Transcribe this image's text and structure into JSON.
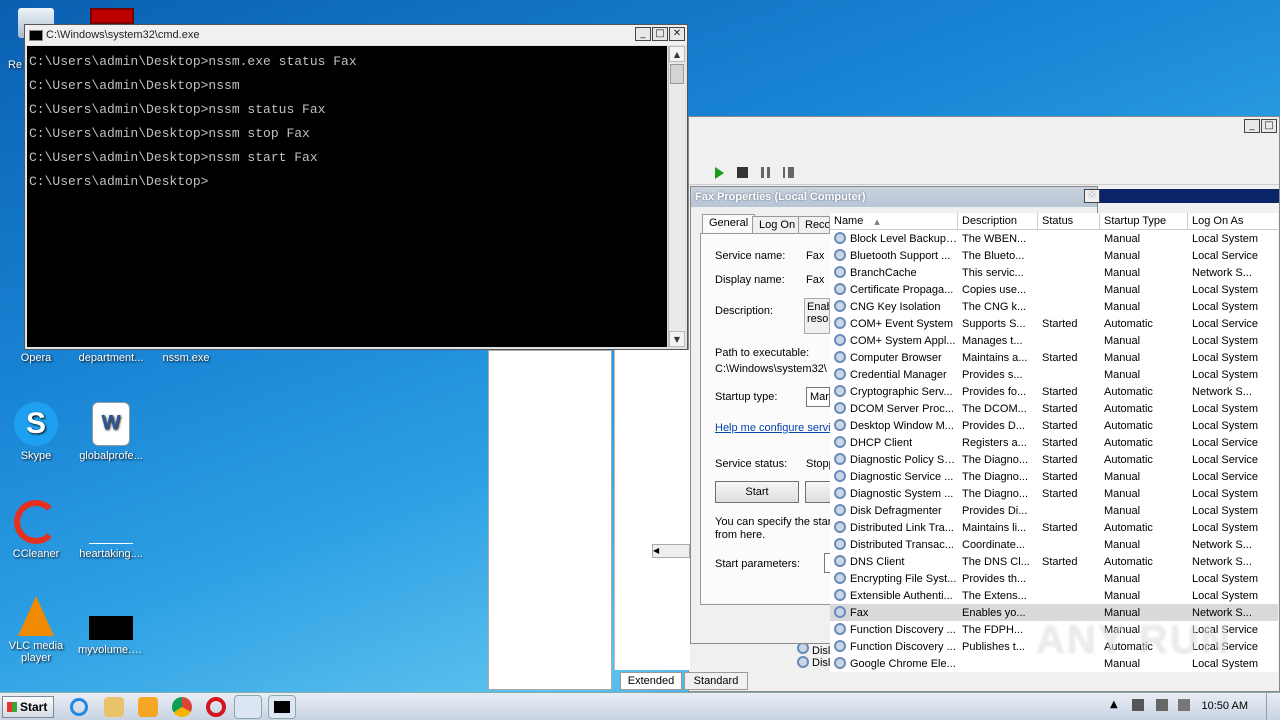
{
  "desktop": {
    "icons": [
      {
        "label": "Opera",
        "color": "#d4141e"
      },
      {
        "label": "department...",
        "color": "#2f7fd0"
      },
      {
        "label": "nssm.exe",
        "color": "#5a6f8a"
      },
      {
        "label": "Skype",
        "color": "#1ea0f0"
      },
      {
        "label": "globalprofe...",
        "color": "#2b579a"
      },
      {
        "label": "CCleaner",
        "color": "#e53020"
      },
      {
        "label": "heartaking....",
        "color": "#ffffff"
      },
      {
        "label": "VLC media player",
        "color": "#f08a00"
      },
      {
        "label": "myvolume.jpg",
        "color": "#000000"
      }
    ],
    "partial_labels": [
      "Re"
    ]
  },
  "cmd": {
    "title": "C:\\Windows\\system32\\cmd.exe",
    "lines": [
      "C:\\Users\\admin\\Desktop>nssm.exe status Fax",
      "C:\\Users\\admin\\Desktop>nssm",
      "C:\\Users\\admin\\Desktop>nssm status Fax",
      "C:\\Users\\admin\\Desktop>nssm stop Fax",
      "C:\\Users\\admin\\Desktop>nssm start Fax",
      "C:\\Users\\admin\\Desktop>"
    ]
  },
  "fax": {
    "title": "Fax Properties (Local Computer)",
    "tabs": [
      "General",
      "Log On",
      "Reco"
    ],
    "service_name_label": "Service name:",
    "service_name_value": "Fax",
    "display_name_label": "Display name:",
    "display_name_value": "Fax",
    "description_label": "Description:",
    "description_value_1": "Enab",
    "description_value_2": "reso",
    "path_label": "Path to executable:",
    "path_value": "C:\\Windows\\system32\\",
    "startup_type_label": "Startup type:",
    "startup_type_value": "Mar",
    "help_link": "Help me configure servic",
    "status_label": "Service status:",
    "status_value": "Stopp",
    "start_button": "Start",
    "hint_1": "You can specify the star",
    "hint_2": "from here.",
    "params_label": "Start parameters:"
  },
  "services": {
    "columns": [
      "Name",
      "Description",
      "Status",
      "Startup Type",
      "Log On As"
    ],
    "rows": [
      [
        "Block Level Backup ...",
        "The WBEN...",
        "",
        "Manual",
        "Local System"
      ],
      [
        "Bluetooth Support ...",
        "The Blueto...",
        "",
        "Manual",
        "Local Service"
      ],
      [
        "BranchCache",
        "This servic...",
        "",
        "Manual",
        "Network S..."
      ],
      [
        "Certificate Propaga...",
        "Copies use...",
        "",
        "Manual",
        "Local System"
      ],
      [
        "CNG Key Isolation",
        "The CNG k...",
        "",
        "Manual",
        "Local System"
      ],
      [
        "COM+ Event System",
        "Supports S...",
        "Started",
        "Automatic",
        "Local Service"
      ],
      [
        "COM+ System Appl...",
        "Manages t...",
        "",
        "Manual",
        "Local System"
      ],
      [
        "Computer Browser",
        "Maintains a...",
        "Started",
        "Manual",
        "Local System"
      ],
      [
        "Credential Manager",
        "Provides s...",
        "",
        "Manual",
        "Local System"
      ],
      [
        "Cryptographic Serv...",
        "Provides fo...",
        "Started",
        "Automatic",
        "Network S..."
      ],
      [
        "DCOM Server Proc...",
        "The DCOM...",
        "Started",
        "Automatic",
        "Local System"
      ],
      [
        "Desktop Window M...",
        "Provides D...",
        "Started",
        "Automatic",
        "Local System"
      ],
      [
        "DHCP Client",
        "Registers a...",
        "Started",
        "Automatic",
        "Local Service"
      ],
      [
        "Diagnostic Policy Se...",
        "The Diagno...",
        "Started",
        "Automatic",
        "Local Service"
      ],
      [
        "Diagnostic Service ...",
        "The Diagno...",
        "Started",
        "Manual",
        "Local Service"
      ],
      [
        "Diagnostic System ...",
        "The Diagno...",
        "Started",
        "Manual",
        "Local System"
      ],
      [
        "Disk Defragmenter",
        "Provides Di...",
        "",
        "Manual",
        "Local System"
      ],
      [
        "Distributed Link Tra...",
        "Maintains li...",
        "Started",
        "Automatic",
        "Local System"
      ],
      [
        "Distributed Transac...",
        "Coordinate...",
        "",
        "Manual",
        "Network S..."
      ],
      [
        "DNS Client",
        "The DNS Cl...",
        "Started",
        "Automatic",
        "Network S..."
      ],
      [
        "Encrypting File Syst...",
        "Provides th...",
        "",
        "Manual",
        "Local System"
      ],
      [
        "Extensible Authenti...",
        "The Extens...",
        "",
        "Manual",
        "Local System"
      ],
      [
        "Fax",
        "Enables yo...",
        "",
        "Manual",
        "Network S..."
      ],
      [
        "Function Discovery ...",
        "The FDPH...",
        "",
        "Manual",
        "Local Service"
      ],
      [
        "Function Discovery ...",
        "Publishes t...",
        "",
        "Automatic",
        "Local Service"
      ],
      [
        "Google Chrome Ele...",
        "",
        "",
        "Manual",
        "Local System"
      ]
    ],
    "selected_index": 22,
    "left_items": [
      "Disl",
      "Disl"
    ],
    "bottom_tabs": [
      "Extended",
      "Standard"
    ]
  },
  "watermark": "ANY RUN",
  "taskbar": {
    "start_label": "Start",
    "clock": "10:50 AM"
  }
}
